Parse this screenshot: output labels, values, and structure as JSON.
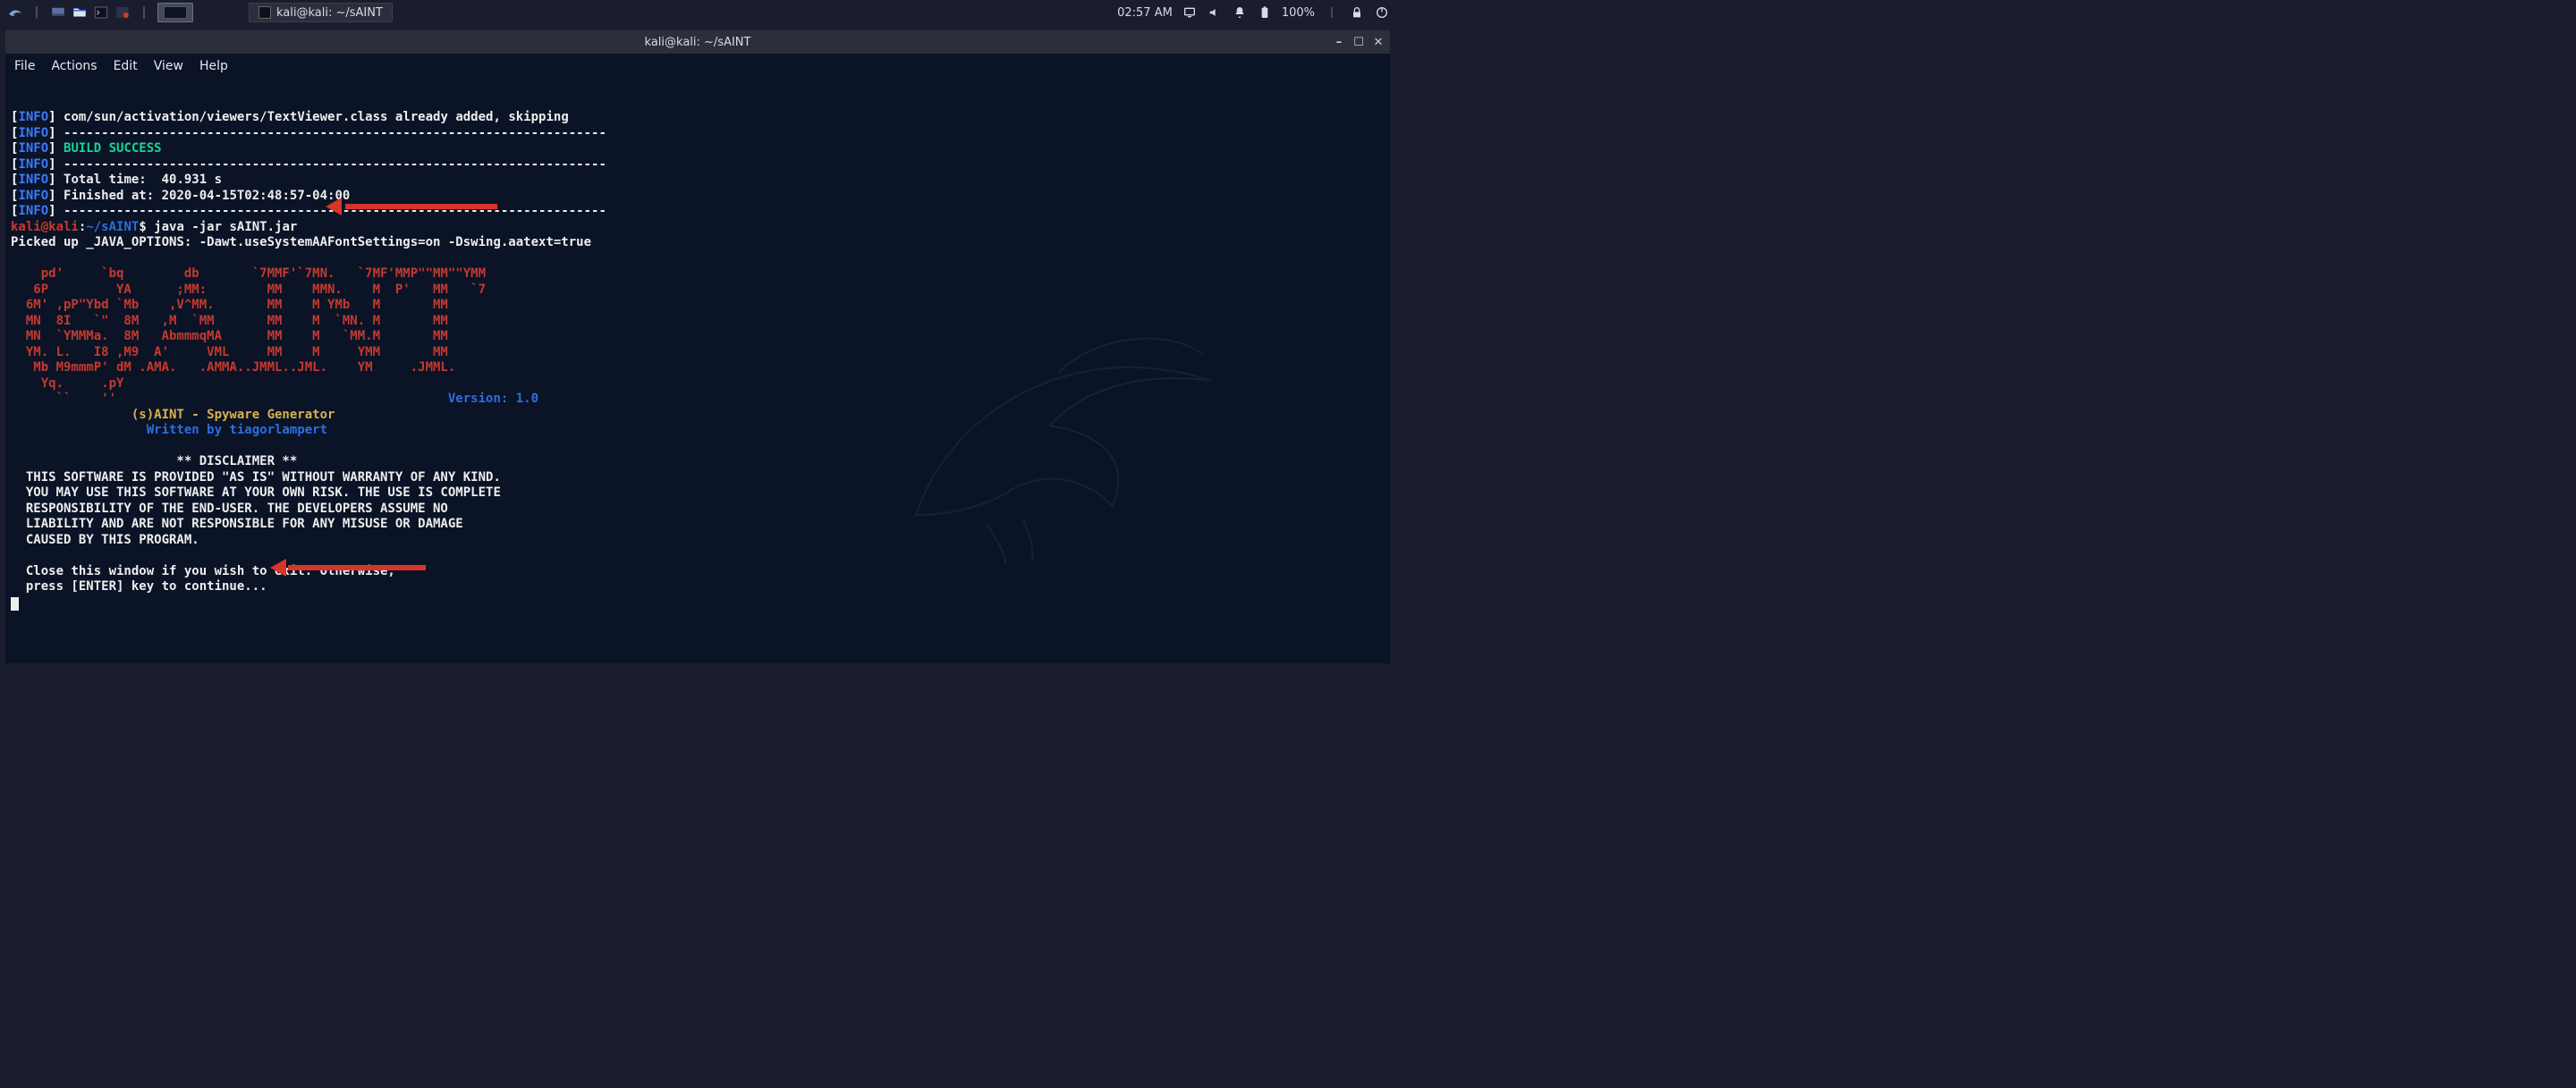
{
  "panel": {
    "task_title": "kali@kali: ~/sAINT",
    "time": "02:57 AM",
    "battery": "100%"
  },
  "window": {
    "title": "kali@kali: ~/sAINT"
  },
  "menu": {
    "file": "File",
    "actions": "Actions",
    "edit": "Edit",
    "view": "View",
    "help": "Help"
  },
  "term": {
    "info_open": "[",
    "info_word": "INFO",
    "info_close": "]",
    "line_added": " com/sun/activation/viewers/TextViewer.class already added, skipping",
    "divider": " ------------------------------------------------------------------------",
    "build_success": " BUILD SUCCESS",
    "total_time": " Total time:  40.931 s",
    "finished_at": " Finished at: 2020-04-15T02:48:57-04:00",
    "prompt_user": "kali@kali",
    "prompt_colon": ":",
    "prompt_path": "~/sAINT",
    "prompt_dollar": "$",
    "command": " java -jar sAINT.jar",
    "picked": "Picked up _JAVA_OPTIONS: -Dawt.useSystemAAFontSettings=on -Dswing.aatext=true",
    "art1": "    pd'     `bq        db       `7MMF'`7MN.   `7MF'MMP\"\"MM\"\"YMM",
    "art2": "   6P         YA      ;MM:        MM    MMN.    M  P'   MM   `7",
    "art3": "  6M' ,pP\"Ybd `Mb    ,V^MM.       MM    M YMb   M       MM",
    "art4": "  MN  8I   `\"  8M   ,M  `MM       MM    M  `MN. M       MM",
    "art5": "  MN  `YMMMa.  8M   AbmmmqMA      MM    M   `MM.M       MM",
    "art6": "  YM. L.   I8 ,M9  A'     VML     MM    M     YMM       MM",
    "art7": "   Mb M9mmmP' dM .AMA.   .AMMA..JMML..JML.    YM     .JMML.",
    "art8": "    Yq.     .pY",
    "art9": "      ``    ''",
    "version_label": "                                            Version: ",
    "version_val": "1.0",
    "title_line": "                (s)AINT - Spyware Generator",
    "author_line": "                  Written by tiagorlampert",
    "disclaimer_hdr": "                      ** DISCLAIMER **",
    "disc1": "  THIS SOFTWARE IS PROVIDED \"AS IS\" WITHOUT WARRANTY OF ANY KIND.",
    "disc2": "  YOU MAY USE THIS SOFTWARE AT YOUR OWN RISK. THE USE IS COMPLETE",
    "disc3": "  RESPONSIBILITY OF THE END-USER. THE DEVELOPERS ASSUME NO",
    "disc4": "  LIABILITY AND ARE NOT RESPONSIBLE FOR ANY MISUSE OR DAMAGE",
    "disc5": "  CAUSED BY THIS PROGRAM.",
    "close1": "  Close this window if you wish to exit. Otherwise,",
    "close2": "  press [ENTER] key to continue",
    "dots": "..."
  }
}
